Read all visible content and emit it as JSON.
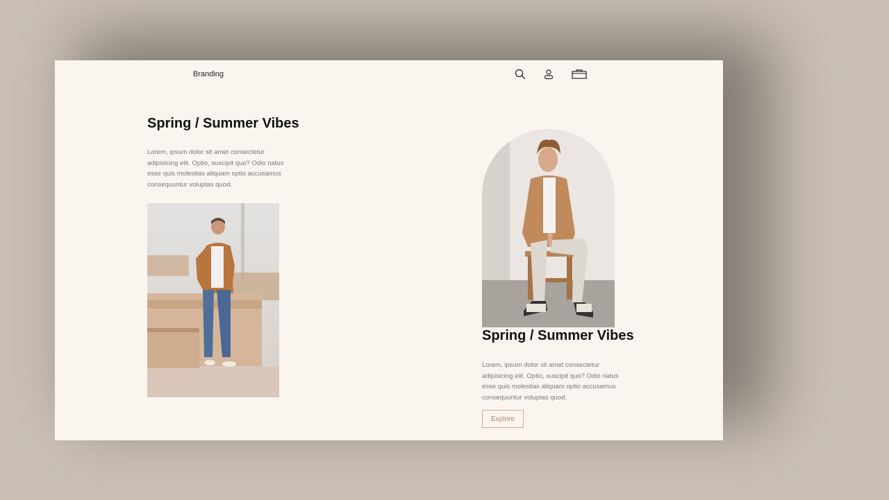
{
  "header": {
    "brand": "Branding"
  },
  "left_section": {
    "title": "Spring / Summer Vibes",
    "text": "Lorem, ipsum dolor sit amet consectetur adipisicing elit. Optio, suscipit quo? Odio natus esse quis molestias aliquam optio accusamus consequuntur voluptas quod."
  },
  "right_section": {
    "title": "Spring / Summer Vibes",
    "text": "Lorem, ipsum dolor sit amet consectetur adipisicing elit. Optio, suscipit quo? Odio natus esse quis molestias aliquam optio accusamus consequuntur voluptas quod.",
    "button_label": "Explore"
  },
  "colors": {
    "page_background": "#faf6ef",
    "outer_background": "#c9bfb5",
    "accent": "#d6a594"
  },
  "icons": [
    "search-icon",
    "user-icon",
    "bag-icon"
  ]
}
